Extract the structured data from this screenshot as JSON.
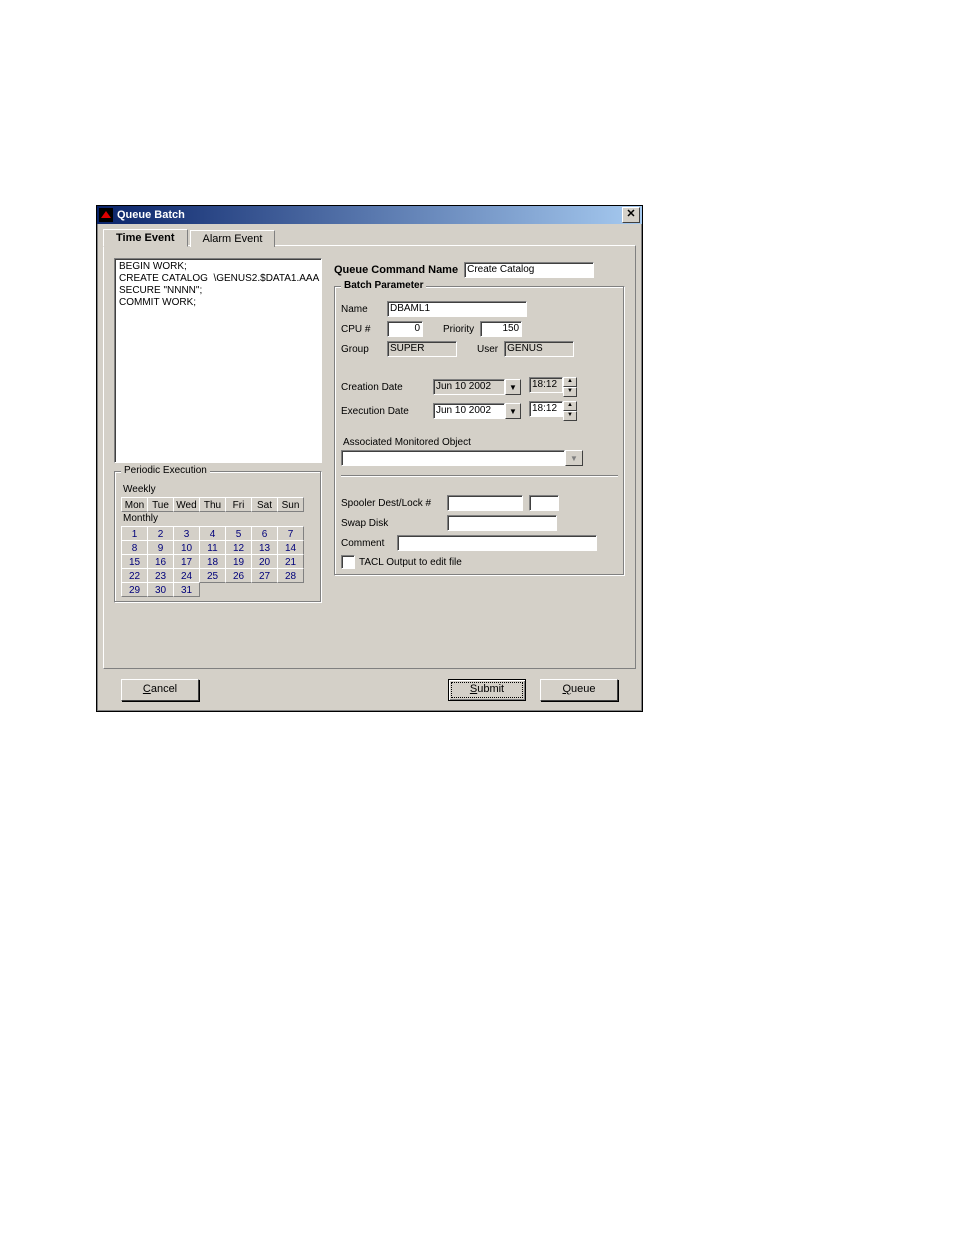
{
  "title": "Queue Batch",
  "tabs": {
    "time_event": "Time Event",
    "alarm_event": "Alarm Event"
  },
  "script_text": "BEGIN WORK;\nCREATE CATALOG  \\GENUS2.$DATA1.AAA\nSECURE \"NNNN\";\nCOMMIT WORK;",
  "periodic": {
    "legend": "Periodic Execution",
    "weekly_label": "Weekly",
    "monthly_label": "Monthly",
    "days": [
      "Mon",
      "Tue",
      "Wed",
      "Thu",
      "Fri",
      "Sat",
      "Sun"
    ],
    "month_days": [
      "1",
      "2",
      "3",
      "4",
      "5",
      "6",
      "7",
      "8",
      "9",
      "10",
      "11",
      "12",
      "13",
      "14",
      "15",
      "16",
      "17",
      "18",
      "19",
      "20",
      "21",
      "22",
      "23",
      "24",
      "25",
      "26",
      "27",
      "28",
      "29",
      "30",
      "31"
    ]
  },
  "queue_command_name_label": "Queue Command Name",
  "queue_command_name": "Create Catalog",
  "batch_param": {
    "legend": "Batch Parameter",
    "name_label": "Name",
    "name": "DBAML1",
    "cpu_label": "CPU #",
    "cpu": "0",
    "priority_label": "Priority",
    "priority": "150",
    "group_label": "Group",
    "group": "SUPER",
    "user_label": "User",
    "user": "GENUS"
  },
  "creation": {
    "label": "Creation Date",
    "date": "Jun 10 2002",
    "time": "18:12"
  },
  "execution": {
    "label": "Execution Date",
    "date": "Jun 10 2002",
    "time": "18:12"
  },
  "assoc_label": "Associated Monitored Object",
  "assoc_value": "",
  "spooler_label": "Spooler Dest/Lock #",
  "spooler_dest": "",
  "spooler_lock": "",
  "swap_label": "Swap Disk",
  "swap_value": "",
  "comment_label": "Comment",
  "comment_value": "",
  "tacl_label": "TACL Output to edit file",
  "buttons": {
    "cancel": "Cancel",
    "submit": "Submit",
    "queue": "Queue"
  }
}
